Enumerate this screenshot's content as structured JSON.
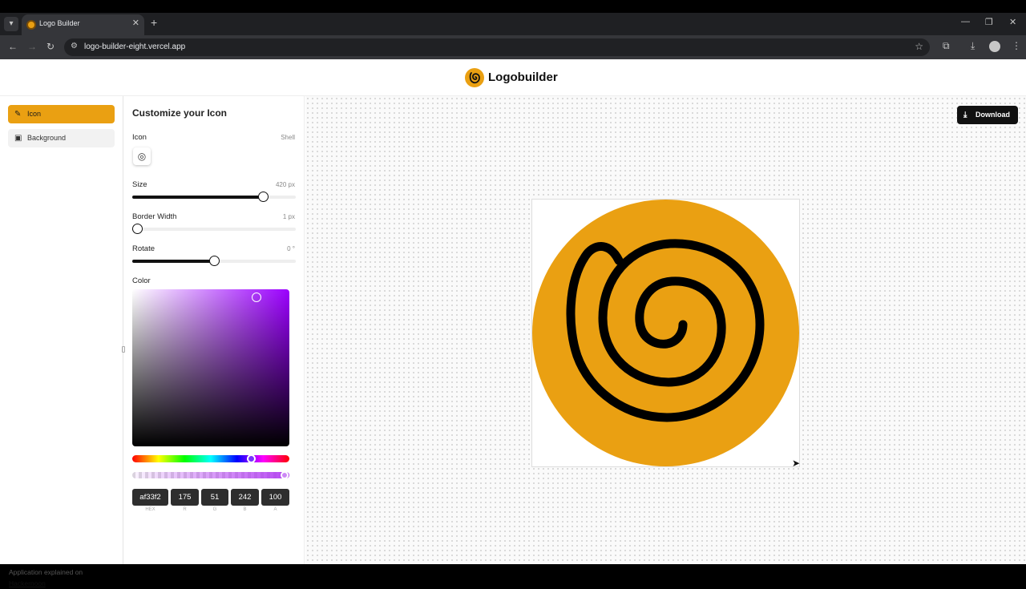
{
  "browser": {
    "tab_title": "Logo Builder",
    "url": "logo-builder-eight.vercel.app",
    "icons": [
      "tab-search-icon",
      "close-icon",
      "plus-icon",
      "minimize-icon",
      "restore-icon",
      "close-window-icon",
      "back-icon",
      "forward-icon",
      "reload-icon",
      "site-info-icon",
      "star-icon",
      "extensions-icon",
      "download-icon",
      "profile-icon",
      "more-icon"
    ]
  },
  "header": {
    "title": "Logobuilder",
    "accent": "#eaa012"
  },
  "nav": {
    "items": [
      {
        "label": "Icon",
        "active": true
      },
      {
        "label": "Background",
        "active": false
      }
    ],
    "credit_text": "Application explained on",
    "credit_link": "Hackernoon"
  },
  "panel": {
    "title": "Customize your Icon",
    "icon_label": "Icon",
    "icon_name": "Shell",
    "size_label": "Size",
    "size_value": "420 px",
    "size_level": 0.8,
    "border_label": "Border Width",
    "border_value": "1 px",
    "border_level": 0.03,
    "rotate_label": "Rotate",
    "rotate_value": "0 °",
    "rotate_level": 0.5,
    "color_label": "Color",
    "color": {
      "hex": "af33f2",
      "r": "175",
      "g": "51",
      "b": "242",
      "a": "100",
      "hex_label": "HEX",
      "r_label": "R",
      "g_label": "G",
      "b_label": "B",
      "a_label": "A"
    }
  },
  "canvas": {
    "download_label": "Download",
    "background_color": "#eaa012",
    "icon_color": "#000000"
  }
}
